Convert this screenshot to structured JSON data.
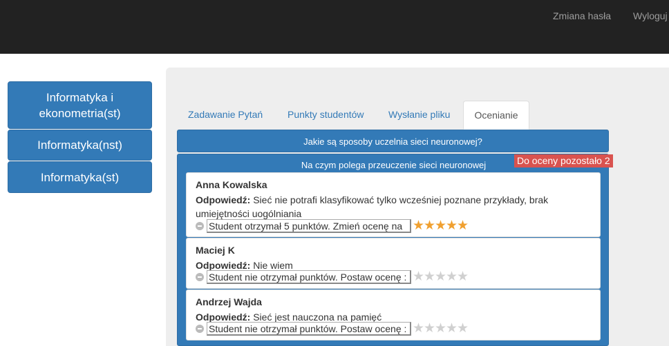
{
  "nav": {
    "change_password": "Zmiana hasła",
    "logout": "Wyloguj"
  },
  "sidebar": {
    "items": [
      {
        "label": "Informatyka i ekonometria(st)"
      },
      {
        "label": "Informatyka(nst)"
      },
      {
        "label": "Informatyka(st)"
      }
    ]
  },
  "tabs": [
    {
      "label": "Zadawanie Pytań"
    },
    {
      "label": "Punkty studentów"
    },
    {
      "label": "Wysłanie pliku"
    },
    {
      "label": "Ocenianie",
      "active": true
    }
  ],
  "questions": [
    {
      "text": "Jakie są sposoby uczelnia sieci neuronowej?"
    },
    {
      "text": "Na czym polega przeuczenie sieci neuronowej",
      "badge": "Do oceny pozostało 2"
    }
  ],
  "answer_label": "Odpowiedź:",
  "answers": [
    {
      "name": "Anna Kowalska",
      "text": "Sieć nie potrafi klasyfikować tylko wcześniej poznane przykłady, brak umiejętności uogólniania",
      "grade_text": "Student otrzymał 5 punktów. Zmień ocenę na",
      "stars": 5
    },
    {
      "name": "Maciej K",
      "text": "Nie wiem",
      "grade_text": "Student nie otrzymał punktów. Postaw ocenę :",
      "stars": 0
    },
    {
      "name": "Andrzej Wajda",
      "text": "Sieć jest nauczona na pamięć",
      "grade_text": "Student nie otrzymał punktów. Postaw ocenę :",
      "stars": 0
    }
  ],
  "colors": {
    "primary": "#337ab7",
    "topbar": "#222222",
    "badge": "#d9534f",
    "star_on": "#f0a030",
    "star_off": "#d0d0d0"
  }
}
